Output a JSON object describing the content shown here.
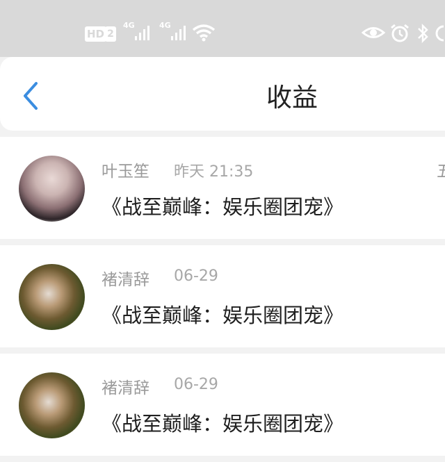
{
  "status_bar": {
    "hd": "HD",
    "sim": "2",
    "net1": "4G",
    "net2": "4G"
  },
  "header": {
    "title": "收益"
  },
  "items": [
    {
      "name": "叶玉笙",
      "time": "昨天 21:35",
      "book": "《战至巅峰：娱乐圈团宠》",
      "edge": "五"
    },
    {
      "name": "褚清辞",
      "time": "06-29",
      "book": "《战至巅峰：娱乐圈团宠》"
    },
    {
      "name": "褚清辞",
      "time": "06-29",
      "book": "《战至巅峰：娱乐圈团宠》"
    }
  ],
  "colors": {
    "accent": "#3b8de0",
    "status_bar_bg": "#d9d9d9"
  }
}
